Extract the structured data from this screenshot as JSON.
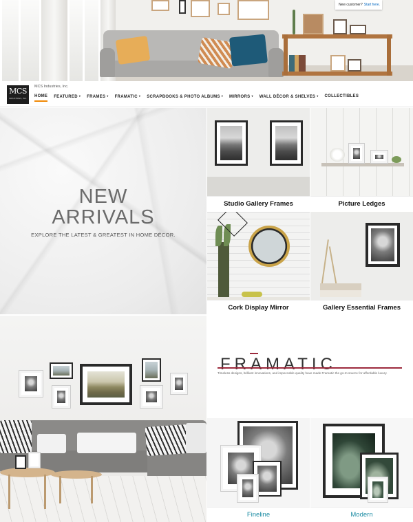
{
  "signin": {
    "prompt": "New customer?",
    "link": "Start here."
  },
  "brand": {
    "logo_text": "MCS",
    "logo_subtext": "INDUSTRIES, INC.",
    "company_name": "MCS Industries, Inc."
  },
  "nav": {
    "items": [
      {
        "label": "HOME",
        "active": true,
        "dropdown": false
      },
      {
        "label": "FEATURED",
        "active": false,
        "dropdown": true
      },
      {
        "label": "FRAMES",
        "active": false,
        "dropdown": true
      },
      {
        "label": "FRAMATIC",
        "active": false,
        "dropdown": true
      },
      {
        "label": "SCRAPBOOKS & PHOTO ALBUMS",
        "active": false,
        "dropdown": true
      },
      {
        "label": "MIRRORS",
        "active": false,
        "dropdown": true
      },
      {
        "label": "WALL DÉCOR & SHELVES",
        "active": false,
        "dropdown": true
      },
      {
        "label": "COLLECTIBLES",
        "active": false,
        "dropdown": false
      }
    ],
    "accent_color": "#f08804"
  },
  "new_arrivals": {
    "line1": "NEW",
    "line2": "ARRIVALS",
    "subtitle": "EXPLORE THE LATEST & GREATEST IN HOME DÉCOR."
  },
  "tiles": {
    "studio_gallery": "Studio Gallery Frames",
    "picture_ledges": "Picture Ledges",
    "cork_mirror": "Cork Display Mirror",
    "gallery_essential": "Gallery Essential Frames",
    "fineline": "Fineline",
    "modern": "Modern"
  },
  "framatic": {
    "wordmark": "FRAMATIC",
    "description": "Timeless designs, brilliant innovations, and impeccable quality have made Framatic the go-to source for affordable luxury.",
    "accent_color": "#9c2a3c",
    "link_color": "#1b8ba3"
  }
}
